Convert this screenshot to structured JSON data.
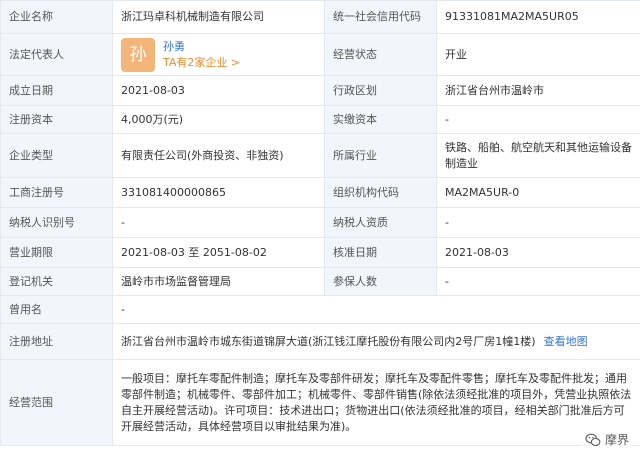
{
  "company_name": {
    "label": "企业名称",
    "value": "浙江玛卓科机械制造有限公司"
  },
  "credit_code": {
    "label": "统一社会信用代码",
    "value": "91331081MA2MA5UR05"
  },
  "legal_rep": {
    "label": "法定代表人",
    "avatar_char": "孙",
    "name": "孙勇",
    "link": "TA有2家企业 >"
  },
  "status": {
    "label": "经营状态",
    "value": "开业"
  },
  "founded": {
    "label": "成立日期",
    "value": "2021-08-03"
  },
  "region": {
    "label": "行政区划",
    "value": "浙江省台州市温岭市"
  },
  "reg_capital": {
    "label": "注册资本",
    "value": "4,000万(元)"
  },
  "paid_capital": {
    "label": "实缴资本",
    "value": "-"
  },
  "company_type": {
    "label": "企业类型",
    "value": "有限责任公司(外商投资、非独资)"
  },
  "industry": {
    "label": "所属行业",
    "value": "铁路、船舶、航空航天和其他运输设备制造业"
  },
  "reg_no": {
    "label": "工商注册号",
    "value": "331081400000865"
  },
  "org_code": {
    "label": "组织机构代码",
    "value": "MA2MA5UR-0"
  },
  "taxpayer_id": {
    "label": "纳税人识别号",
    "value": "-"
  },
  "taxpayer_qual": {
    "label": "纳税人资质",
    "value": "-"
  },
  "biz_term": {
    "label": "营业期限",
    "value": "2021-08-03 至 2051-08-02"
  },
  "approval_date": {
    "label": "核准日期",
    "value": "2021-08-03"
  },
  "reg_authority": {
    "label": "登记机关",
    "value": "温岭市市场监督管理局"
  },
  "insured": {
    "label": "参保人数",
    "value": "-"
  },
  "former_name": {
    "label": "曾用名",
    "value": "-"
  },
  "address": {
    "label": "注册地址",
    "value": "浙江省台州市温岭市城东街道锦屏大道(浙江钱江摩托股份有限公司内2号厂房1幢1楼)",
    "map_link": "查看地图"
  },
  "scope": {
    "label": "经营范围",
    "value": "一般项目：摩托车零配件制造；摩托车及零部件研发；摩托车及零配件零售；摩托车及零配件批发；通用零部件制造；机械零件、零部件加工；机械零件、零部件销售(除依法须经批准的项目外，凭营业执照依法自主开展经营活动)。许可项目：技术进出口；货物进出口(依法须经批准的项目，经相关部门批准后方可开展经营活动，具体经营项目以审批结果为准)。"
  },
  "watermark": {
    "text": "摩界",
    "icon": "wechat-icon"
  }
}
